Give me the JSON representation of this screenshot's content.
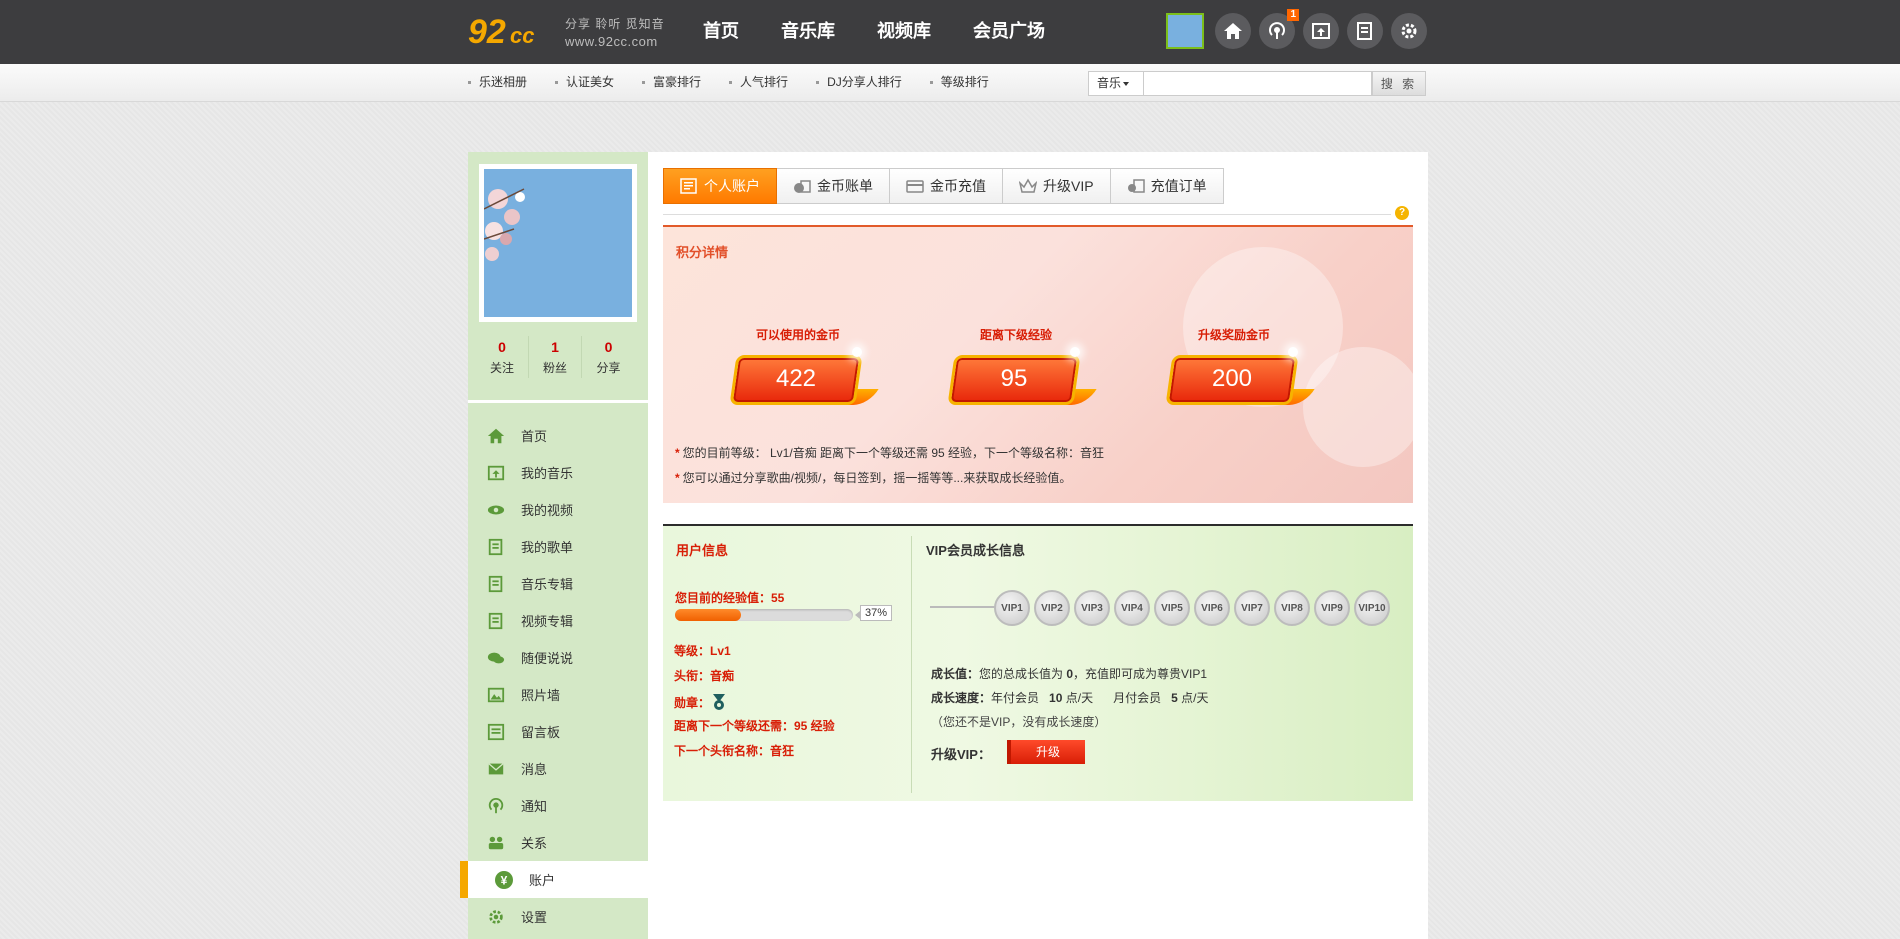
{
  "header": {
    "logo_text": "92cc",
    "slogan": "分享 聆听 觅知音",
    "domain": "www.92cc.com",
    "nav": [
      "首页",
      "音乐库",
      "视频库",
      "会员广场"
    ],
    "notification_count": "1"
  },
  "subnav": {
    "links": [
      "乐迷相册",
      "认证美女",
      "富豪排行",
      "人气排行",
      "DJ分享人排行",
      "等级排行"
    ],
    "search_category": "音乐",
    "search_placeholder": "",
    "search_button": "搜 索"
  },
  "sidebar": {
    "stats": [
      {
        "value": "0",
        "label": "关注"
      },
      {
        "value": "1",
        "label": "粉丝"
      },
      {
        "value": "0",
        "label": "分享"
      }
    ],
    "menu": [
      {
        "label": "首页",
        "icon": "home-icon"
      },
      {
        "label": "我的音乐",
        "icon": "music-icon"
      },
      {
        "label": "我的视频",
        "icon": "eye-icon"
      },
      {
        "label": "我的歌单",
        "icon": "list-icon"
      },
      {
        "label": "音乐专辑",
        "icon": "list-icon"
      },
      {
        "label": "视频专辑",
        "icon": "list-icon"
      },
      {
        "label": "随便说说",
        "icon": "chat-icon"
      },
      {
        "label": "照片墙",
        "icon": "image-icon"
      },
      {
        "label": "留言板",
        "icon": "board-icon"
      },
      {
        "label": "消息",
        "icon": "mail-icon"
      },
      {
        "label": "通知",
        "icon": "broadcast-icon"
      },
      {
        "label": "关系",
        "icon": "people-icon"
      },
      {
        "label": "账户",
        "icon": "yen-icon",
        "active": true
      },
      {
        "label": "设置",
        "icon": "gear-icon"
      }
    ]
  },
  "tabs": [
    "个人账户",
    "金币账单",
    "金币充值",
    "升级VIP",
    "充值订单"
  ],
  "points": {
    "title": "积分详情",
    "items": [
      {
        "label": "可以使用的金币",
        "value": "422"
      },
      {
        "label": "距离下级经验",
        "value": "95"
      },
      {
        "label": "升级奖励金币",
        "value": "200"
      }
    ],
    "note1": "您的目前等级： Lv1/音痴 距离下一个等级还需 95 经验，下一个等级名称：音狂",
    "note2": "您可以通过分享歌曲/视频/，每日签到，摇一摇等等...来获取成长经验值。"
  },
  "user_info": {
    "title": "用户信息",
    "exp_label": "您目前的经验值：55",
    "progress": 0.37,
    "progress_text": "37%",
    "level": "等级：Lv1",
    "rank": "头衔：音痴",
    "medal": "勋章：",
    "next_need": "距离下一个等级还需：95 经验",
    "next_name": "下一个头衔名称：音狂"
  },
  "vip": {
    "title": "VIP会员成长信息",
    "levels": [
      "VIP1",
      "VIP2",
      "VIP3",
      "VIP4",
      "VIP5",
      "VIP6",
      "VIP7",
      "VIP8",
      "VIP9",
      "VIP10"
    ],
    "growth_label": "成长值：",
    "growth_text_a": "您的总成长值为 ",
    "growth_value": "0",
    "growth_text_b": "，充值即可成为尊贵VIP1",
    "speed_label": "成长速度：",
    "speed_year": "年付会员",
    "speed_year_val": "10",
    "speed_unit": "点/天",
    "speed_month": "月付会员",
    "speed_month_val": "5",
    "not_vip": "（您还不是VIP，没有成长速度）",
    "upgrade_label": "升级VIP：",
    "upgrade_button": "升级"
  }
}
